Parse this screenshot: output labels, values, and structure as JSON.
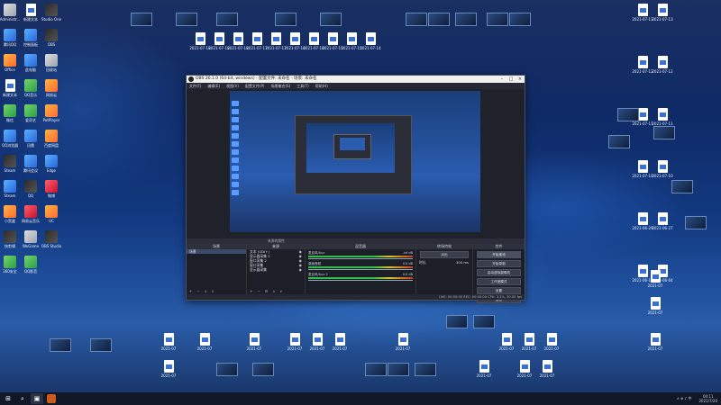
{
  "desktop": {
    "left_icons": [
      {
        "label": "Administr...",
        "kind": "app4"
      },
      {
        "label": "新建文本",
        "kind": "doc"
      },
      {
        "label": "Studio One",
        "kind": "app6"
      },
      {
        "label": "腾讯QQ",
        "kind": "app"
      },
      {
        "label": "控制面板",
        "kind": "app"
      },
      {
        "label": "OBS",
        "kind": "app6"
      },
      {
        "label": "Office",
        "kind": "app2"
      },
      {
        "label": "此电脑",
        "kind": "app"
      },
      {
        "label": "回收站",
        "kind": "app4"
      },
      {
        "label": "新建文本",
        "kind": "doc"
      },
      {
        "label": "QQ音乐",
        "kind": "app3"
      },
      {
        "label": "网易云",
        "kind": "app2"
      },
      {
        "label": "微信",
        "kind": "app3"
      },
      {
        "label": "爱奇艺",
        "kind": "app3"
      },
      {
        "label": "PotPlayer",
        "kind": "app2"
      },
      {
        "label": "QQ浏览器",
        "kind": "app"
      },
      {
        "label": "迅雷",
        "kind": "app"
      },
      {
        "label": "百度网盘",
        "kind": "app2"
      },
      {
        "label": "Steam",
        "kind": "app6"
      },
      {
        "label": "腾讯会议",
        "kind": "app"
      },
      {
        "label": "Edge",
        "kind": "app"
      },
      {
        "label": "Steam",
        "kind": "app"
      },
      {
        "label": "QQ",
        "kind": "app6"
      },
      {
        "label": "微博",
        "kind": "app5"
      },
      {
        "label": "小黑盒",
        "kind": "app2"
      },
      {
        "label": "网易云音乐",
        "kind": "app5"
      },
      {
        "label": "UC",
        "kind": "app2"
      },
      {
        "label": "快剪辑",
        "kind": "app6"
      },
      {
        "label": "WeGame",
        "kind": "app4"
      },
      {
        "label": "OBS Studio",
        "kind": "app6"
      },
      {
        "label": "360安全",
        "kind": "app3"
      },
      {
        "label": "QQ影音",
        "kind": "app3"
      }
    ],
    "file_labels": [
      "2021-07-18",
      "2021-07-18",
      "2021-07-18",
      "2021-07-17",
      "2021-07-17",
      "2021-07-16",
      "2021-07-16",
      "2021-07-15",
      "2021-07-15",
      "2021-07-14"
    ],
    "right_labels": [
      "2021-07-13",
      "2021-07-13",
      "2021-07-12",
      "2021-07-12",
      "2021-07-11",
      "2021-07-11",
      "2021-07-10",
      "2021-07-10",
      "2021-06-29",
      "2021-06-27",
      "2021-06-16",
      "2021-06-04"
    ]
  },
  "obs": {
    "title": "OBS 26.1.0 (64-bit, windows) - 配置文件: 未命名 - 场景: 未命名",
    "menu": [
      "文件(F)",
      "编辑(E)",
      "视图(V)",
      "配置文件(P)",
      "场景集合(S)",
      "工具(T)",
      "帮助(H)"
    ],
    "panels": {
      "scenes": {
        "header": "场景",
        "items": [
          "场景"
        ]
      },
      "sources": {
        "header": "来源",
        "items": [
          "文本 (GDI+)",
          "显示器采集 2",
          "窗口采集 2",
          "窗口采集",
          "显示器采集"
        ]
      },
      "mixer": {
        "header": "混音器",
        "tracks": [
          {
            "name": "麦克风/Aux",
            "db": "-inf dB"
          },
          {
            "name": "桌面音频",
            "db": "0.0 dB"
          },
          {
            "name": "麦克风/Aux 2",
            "db": "0.0 dB"
          }
        ]
      },
      "transitions": {
        "header": "转场特效",
        "type": "淡出",
        "duration_label": "时长",
        "duration": "300 ms"
      },
      "controls": {
        "header": "控件",
        "buttons": [
          "开始推流",
          "开始录制",
          "启动虚拟摄像机",
          "工作室模式",
          "设置",
          "退出"
        ]
      }
    },
    "tabs_label": "来源的属性",
    "status": "LIVE: 00:00:00   REC: 00:00:00   CPU: 3.3%, 30.00 fps"
  },
  "taskbar": {
    "start_glyph": "⊞",
    "search_glyph": "⌕",
    "taskview_glyph": "▣",
    "time": "00:11",
    "date": "2021/7/20",
    "tray_text": "∧  ⊕  ♪  中"
  },
  "colors": {
    "accent": "#2a5cb0",
    "obs_bg": "#2b2e38",
    "meter_green": "#2fbf4d"
  }
}
